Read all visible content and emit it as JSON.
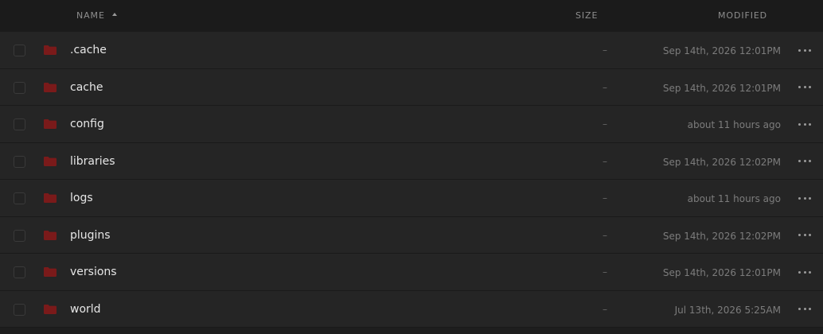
{
  "header": {
    "name_label": "NAME",
    "size_label": "SIZE",
    "modified_label": "MODIFIED",
    "sort": "ascending"
  },
  "colors": {
    "folder": "#7a1a1a",
    "background": "#252525",
    "header_bg": "#1b1b1b"
  },
  "rows": [
    {
      "name": ".cache",
      "size": "–",
      "modified": "Sep 14th, 2026 12:01PM",
      "icon": "folder-icon"
    },
    {
      "name": "cache",
      "size": "–",
      "modified": "Sep 14th, 2026 12:01PM",
      "icon": "folder-icon"
    },
    {
      "name": "config",
      "size": "–",
      "modified": "about 11 hours ago",
      "icon": "folder-icon"
    },
    {
      "name": "libraries",
      "size": "–",
      "modified": "Sep 14th, 2026 12:02PM",
      "icon": "folder-icon"
    },
    {
      "name": "logs",
      "size": "–",
      "modified": "about 11 hours ago",
      "icon": "folder-icon"
    },
    {
      "name": "plugins",
      "size": "–",
      "modified": "Sep 14th, 2026 12:02PM",
      "icon": "folder-icon"
    },
    {
      "name": "versions",
      "size": "–",
      "modified": "Sep 14th, 2026 12:01PM",
      "icon": "folder-icon"
    },
    {
      "name": "world",
      "size": "–",
      "modified": "Jul 13th, 2026 5:25AM",
      "icon": "folder-icon"
    }
  ]
}
